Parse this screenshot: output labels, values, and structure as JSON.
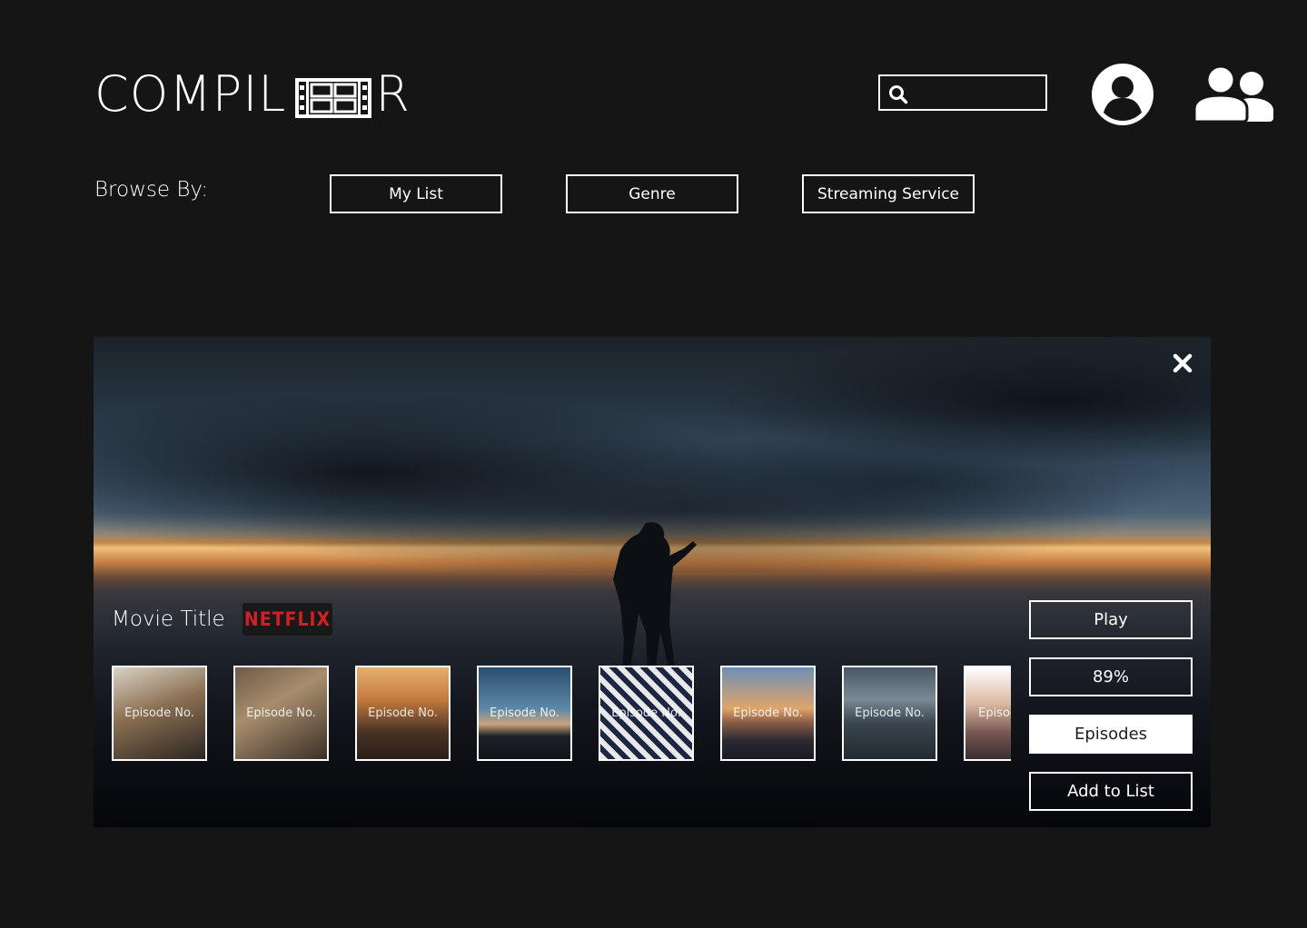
{
  "header": {
    "logo_left": "COMPIL",
    "logo_right": "R",
    "logo_icon": "film-strip-icon",
    "search": {
      "placeholder": "",
      "value": "",
      "icon": "search-icon"
    },
    "profile_icon": "user-circle-icon",
    "group_icon": "users-icon"
  },
  "browse": {
    "label": "Browse By:",
    "buttons": [
      "My List",
      "Genre",
      "Streaming Service"
    ]
  },
  "detail": {
    "close_icon": "close-icon",
    "title": "Movie Title",
    "service_badge": "NETFLIX",
    "episodes": [
      "Episode No.",
      "Episode No.",
      "Episode No.",
      "Episode No.",
      "Episode No.",
      "Episode No.",
      "Episode No.",
      "Episode No."
    ],
    "actions": {
      "play": "Play",
      "score": "89%",
      "episodes": "Episodes",
      "add_to_list": "Add to List"
    }
  },
  "colors": {
    "background": "#151515",
    "netflix_red": "#d21f26",
    "text": "#ffffff"
  }
}
